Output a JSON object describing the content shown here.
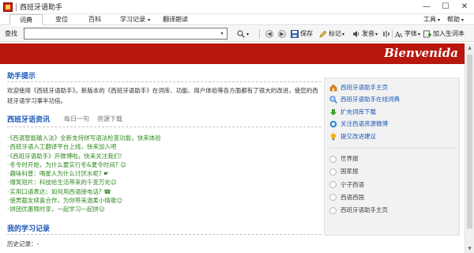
{
  "window": {
    "title": "西班牙语助手",
    "minimize": "—",
    "maximize": "☐",
    "close": "✕"
  },
  "menu": {
    "tabs": [
      {
        "label": "词典",
        "active": true
      },
      {
        "label": "变位",
        "active": false
      },
      {
        "label": "百科",
        "active": false
      },
      {
        "label": "学习记录",
        "active": false,
        "dropdown": true
      },
      {
        "label": "翻译朗读",
        "active": false
      }
    ],
    "tools": "工具",
    "help": "帮助",
    "caret": "▾"
  },
  "toolbar": {
    "search_label": "查找",
    "search_value": "",
    "search_placeholder": "",
    "save": "保存",
    "bookmark": "标记",
    "pronounce": "发音",
    "font": "字体",
    "add_to_wordbook": "加入生词本",
    "back_symbol": "◀",
    "forward_symbol": "▶"
  },
  "header": {
    "welcome": "Bienvenida"
  },
  "help_section": {
    "title": "助手提示",
    "text": "欢迎使用《西班牙语助手》。新版本的《西班牙语助手》在词库、功能、用户体验等各方面都有了很大的改进，使您的西班牙语学习事半功倍。"
  },
  "news": {
    "tabs": [
      {
        "label": "西班牙语资讯",
        "active": true
      },
      {
        "label": "每日一句",
        "active": false
      },
      {
        "label": "资源下载",
        "active": false
      }
    ],
    "items": [
      "《西语智能输入法》全新支持拼写语法检查功能，快来体验",
      "西班牙语人工翻译平台上线，快来加入吧",
      "《西班牙语助手》开微博啦，快来关注我们！",
      "冬令时开始，为什么要实行冬&夏令时间? ☺",
      "趣味科普：喝星人为什么讨厌水呢? ☛",
      "爆笑短片：科技给生活带来的千变万化☺",
      "实用口语表达：如何用西语接电话? ☎",
      "使男截女续喜合作，为你带来温柔小情歌☺",
      "拼团优惠限时享，一起学习一起拼☺"
    ]
  },
  "study": {
    "title": "我的学习记录",
    "history_label": "历史记录：-"
  },
  "side_panel": {
    "links": [
      {
        "label": "西班牙语助手主页",
        "icon": "home-icon",
        "color": "#e08a1e"
      },
      {
        "label": "西班牙语助手在线词典",
        "icon": "search-globe-icon",
        "color": "#2b6fd1"
      },
      {
        "label": "扩充词库下载",
        "icon": "download-arrow-icon",
        "color": "#3aa02e"
      },
      {
        "label": "关注西语资源微博",
        "icon": "weibo-icon",
        "color": "#2b8bd6"
      },
      {
        "label": "提交改进建议",
        "icon": "lightbulb-icon",
        "color": "#f0b400"
      }
    ],
    "radios": [
      {
        "label": "世界报"
      },
      {
        "label": "国家报"
      },
      {
        "label": "宁子西语"
      },
      {
        "label": "西语西国"
      },
      {
        "label": "西班牙语助手主页"
      }
    ]
  },
  "colors": {
    "header_red": "#b7170c",
    "link_blue": "#1b58b8",
    "news_green": "#2f8a1f"
  }
}
